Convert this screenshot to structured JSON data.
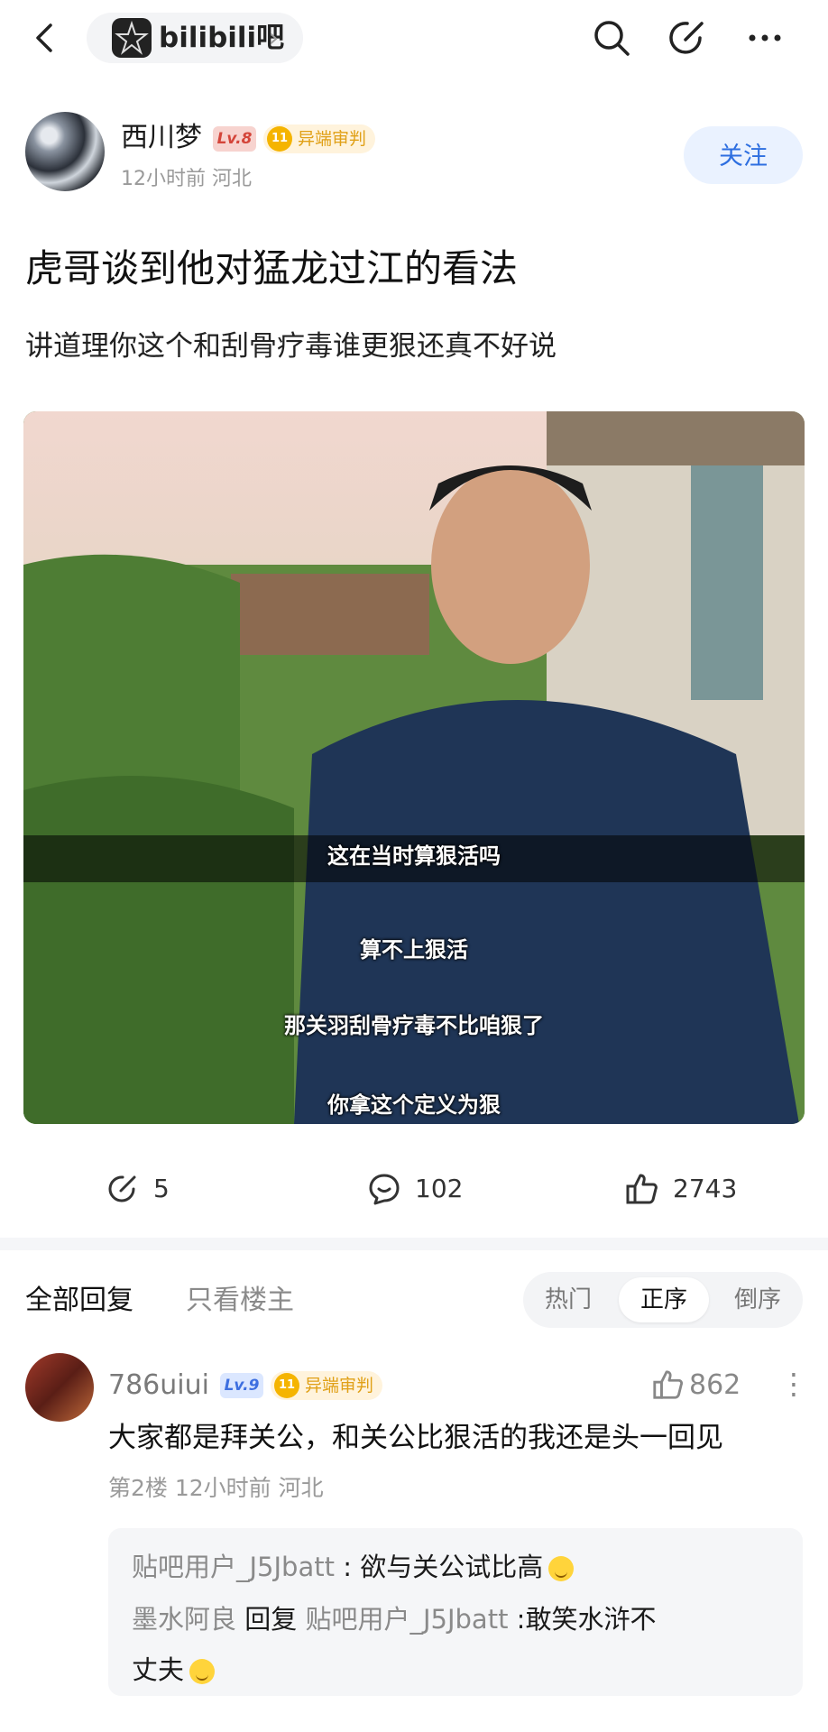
{
  "header": {
    "forum_name": "bilibili吧",
    "chevron": "›",
    "icons": [
      "back-arrow-icon",
      "search-icon",
      "edit-icon",
      "more-icon"
    ]
  },
  "post": {
    "author": "西川梦",
    "level": "Lv.8",
    "honor_medal": "11",
    "honor_title": "异端审判",
    "time_location": "12小时前  河北",
    "follow_label": "关注",
    "title": "虎哥谈到他对猛龙过江的看法",
    "body": "讲道理你这个和刮骨疗毒谁更狠还真不好说",
    "image": {
      "subtitles": [
        "这在当时算狠活吗",
        "算不上狠活",
        "那关羽刮骨疗毒不比咱狠了",
        "你拿这个定义为狠"
      ]
    },
    "stats": {
      "shares": "5",
      "comments": "102",
      "likes": "2743"
    }
  },
  "tabs": {
    "all_replies": "全部回复",
    "host_only": "只看楼主",
    "sort": [
      "热门",
      "正序",
      "倒序"
    ],
    "sort_selected": "正序"
  },
  "comment": {
    "user": "786uiui",
    "level": "Lv.9",
    "honor_medal": "11",
    "honor_title": "异端审判",
    "likes": "862",
    "more": "⋮",
    "text": "大家都是拜关公，和关公比狠活的我还是头一回见",
    "meta": "第2楼  12小时前  河北",
    "replies": [
      {
        "user": "贴吧用户_J5Jbatt",
        "sep": " : ",
        "text": "欲与关公试比高"
      },
      {
        "user": "墨水阿良",
        "reply_word": "回复",
        "target": "贴吧用户_J5Jbatt",
        "text": " :敢笑水浒不",
        "text2": "丈夫"
      }
    ]
  },
  "colors": {
    "accent": "#2e6fe0",
    "honor": "#e0a017",
    "level8": "#d4453a"
  }
}
